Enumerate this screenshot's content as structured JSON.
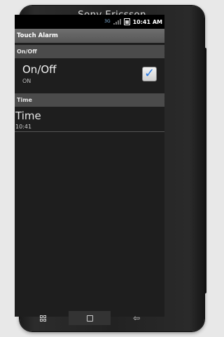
{
  "device": {
    "brand": "Sony Ericsson"
  },
  "status_bar": {
    "network": "3G",
    "time": "10:41 AM"
  },
  "app": {
    "title": "Touch Alarm"
  },
  "sections": {
    "onoff_header": "On/Off",
    "time_header": "Time"
  },
  "onoff_pref": {
    "title": "On/Off",
    "summary": "ON",
    "checked": true
  },
  "time_pref": {
    "title": "Time",
    "summary": "10:41"
  },
  "nav_icons": [
    "menu-icon",
    "home-icon",
    "back-icon"
  ]
}
